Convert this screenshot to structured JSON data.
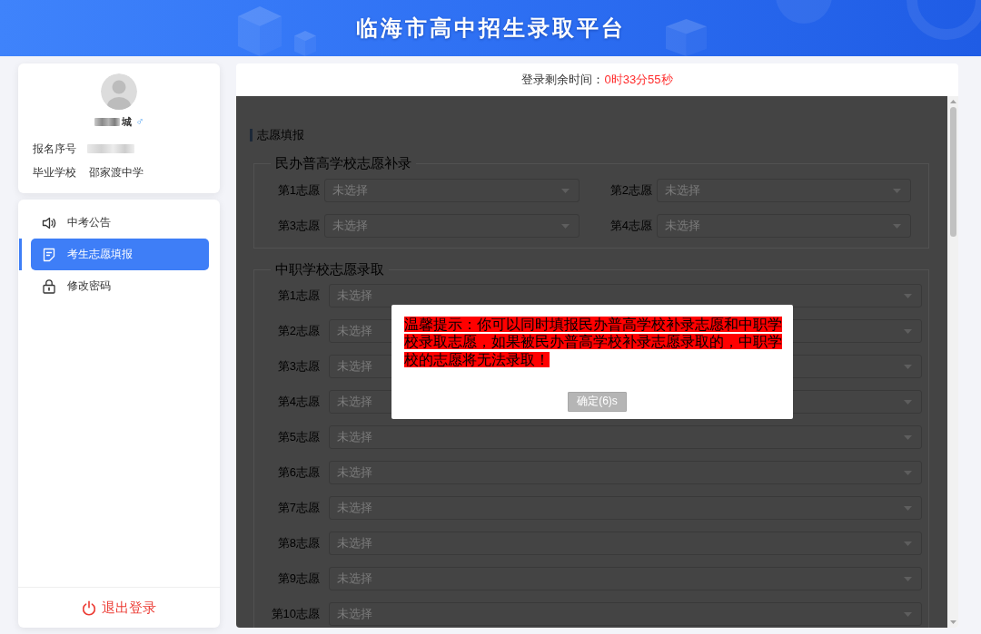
{
  "header": {
    "title": "临海市高中招生录取平台"
  },
  "profile": {
    "name": "城",
    "redacted": true,
    "gender": "♂",
    "fields": [
      {
        "label": "报名序号",
        "kind": "redacted"
      },
      {
        "label": "毕业学校",
        "kind": "text",
        "value": "邵家渡中学"
      }
    ]
  },
  "menu": [
    {
      "label": "中考公告",
      "selected": false
    },
    {
      "label": "考生志愿填报",
      "selected": true
    },
    {
      "label": "修改密码",
      "selected": false
    }
  ],
  "logout": {
    "label": "退出登录"
  },
  "timer": {
    "label": "登录剩余时间：",
    "value": "0时33分55秒"
  },
  "form": {
    "title": "志愿填报",
    "sections": [
      {
        "legend": "民办普高学校志愿补录",
        "kind": "two_column",
        "choices": [
          {
            "label": "第1志愿",
            "placeholder": "未选择"
          },
          {
            "label": "第2志愿",
            "placeholder": "未选择"
          },
          {
            "label": "第3志愿",
            "placeholder": "未选择"
          },
          {
            "label": "第4志愿",
            "placeholder": "未选择"
          }
        ]
      },
      {
        "legend": "中职学校志愿录取",
        "kind": "single_column",
        "choices": [
          {
            "label": "第1志愿",
            "placeholder": "未选择"
          },
          {
            "label": "第2志愿",
            "placeholder": "未选择"
          },
          {
            "label": "第3志愿",
            "placeholder": "未选择"
          },
          {
            "label": "第4志愿",
            "placeholder": "未选择"
          },
          {
            "label": "第5志愿",
            "placeholder": "未选择"
          },
          {
            "label": "第6志愿",
            "placeholder": "未选择"
          },
          {
            "label": "第7志愿",
            "placeholder": "未选择"
          },
          {
            "label": "第8志愿",
            "placeholder": "未选择"
          },
          {
            "label": "第9志愿",
            "placeholder": "未选择"
          },
          {
            "label": "第10志愿",
            "placeholder": "未选择"
          }
        ]
      }
    ]
  },
  "dialog": {
    "message": "温馨提示：你可以同时填报民办普高学校补录志愿和中职学校录取志愿，如果被民办普高学校补录志愿录取的，中职学校的志愿将无法录取！",
    "button": {
      "label": "确定(6)s",
      "disabled": true
    }
  }
}
